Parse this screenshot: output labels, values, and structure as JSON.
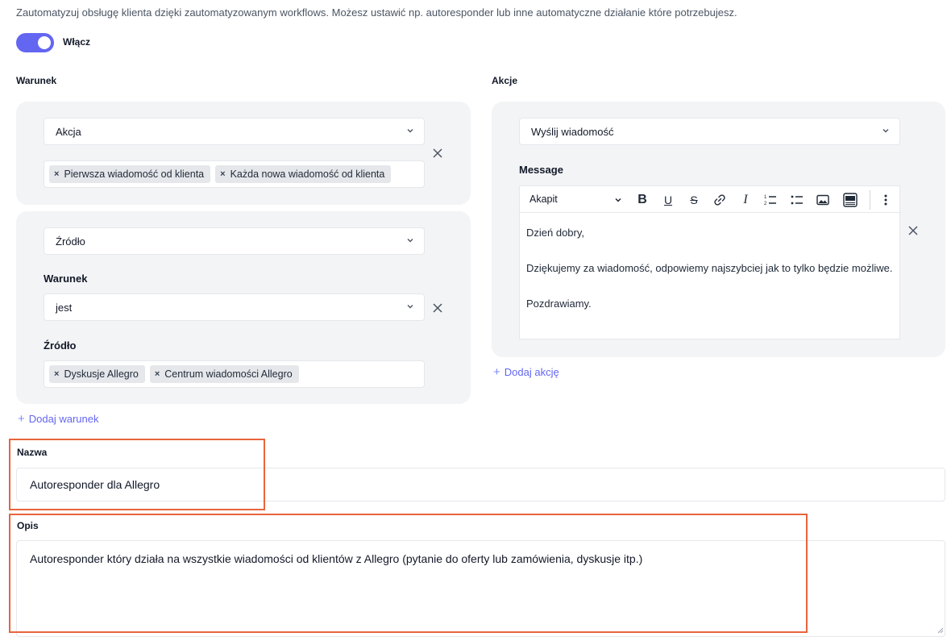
{
  "intro_text": "Zautomatyzuj obsługę klienta dzięki zautomatyzowanym workflows. Możesz ustawić np. autoresponder lub inne automatyczne działanie które potrzebujesz.",
  "toggle": {
    "label": "Włącz",
    "on": true
  },
  "conditions": {
    "title": "Warunek",
    "block1": {
      "select_value": "Akcja",
      "chips": [
        "Pierwsza wiadomość od klienta",
        "Każda nowa wiadomość od klienta"
      ]
    },
    "block2": {
      "select_value": "Źródło",
      "condition_label": "Warunek",
      "condition_value": "jest",
      "source_label": "Źródło",
      "chips": [
        "Dyskusje Allegro",
        "Centrum wiadomości Allegro"
      ]
    },
    "add_label": "Dodaj warunek"
  },
  "actions": {
    "title": "Akcje",
    "select_value": "Wyślij wiadomość",
    "message_label": "Message",
    "toolbar": {
      "paragraph_style": "Akapit",
      "icons": [
        "bold-icon",
        "underline-icon",
        "strikethrough-icon",
        "link-icon",
        "italic-icon",
        "numbered-list-icon",
        "bullet-list-icon",
        "image-icon",
        "html-icon",
        "more-icon"
      ]
    },
    "message_lines": [
      "Dzień dobry,",
      "Dziękujemy za wiadomość, odpowiemy najszybciej jak to tylko będzie możliwe.",
      "Pozdrawiamy."
    ],
    "add_label": "Dodaj akcję"
  },
  "name_field": {
    "label": "Nazwa",
    "value": "Autoresponder dla Allegro"
  },
  "description_field": {
    "label": "Opis",
    "value": "Autoresponder który działa na wszystkie wiadomości od klientów z Allegro (pytanie do oferty lub zamówienia, dyskusje itp.)"
  },
  "colors": {
    "accent": "#6366f1",
    "panel": "#f3f4f6",
    "highlight": "#e8643c"
  }
}
